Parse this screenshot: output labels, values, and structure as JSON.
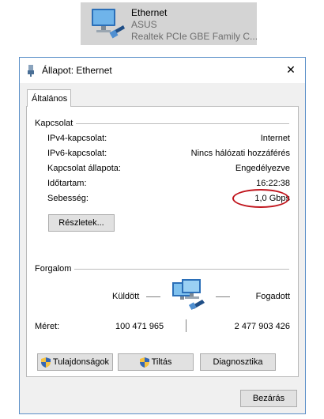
{
  "adapter_tile": {
    "name": "Ethernet",
    "network": "ASUS",
    "device": "Realtek PCIe GBE Family C..."
  },
  "dialog": {
    "title": "Állapot: Ethernet",
    "close_glyph": "✕",
    "tab_label": "Általános",
    "connection": {
      "group_title": "Kapcsolat",
      "rows": [
        {
          "label": "IPv4-kapcsolat:",
          "value": "Internet"
        },
        {
          "label": "IPv6-kapcsolat:",
          "value": "Nincs hálózati hozzáférés"
        },
        {
          "label": "Kapcsolat állapota:",
          "value": "Engedélyezve"
        },
        {
          "label": "Időtartam:",
          "value": "16:22:38"
        },
        {
          "label": "Sebesség:",
          "value": "1,0 Gbps"
        }
      ],
      "details_button": "Részletek..."
    },
    "activity": {
      "group_title": "Forgalom",
      "sent_label": "Küldött",
      "received_label": "Fogadott",
      "bytes_label": "Méret:",
      "bytes_sent": "100 471 965",
      "bytes_received": "2 477 903 426"
    },
    "buttons": {
      "properties": "Tulajdonságok",
      "disable": "Tiltás",
      "diagnose": "Diagnosztika",
      "close": "Bezárás"
    }
  },
  "icons": [
    "network-adapter-icon",
    "ethernet-title-icon",
    "close-icon",
    "network-activity-icon",
    "shield-icon"
  ],
  "colors": {
    "highlight_oval": "#c0141c",
    "window_border": "#5a8fc8",
    "dialog_bg": "#f0f0f0",
    "tile_bg": "#d4d4d4"
  }
}
